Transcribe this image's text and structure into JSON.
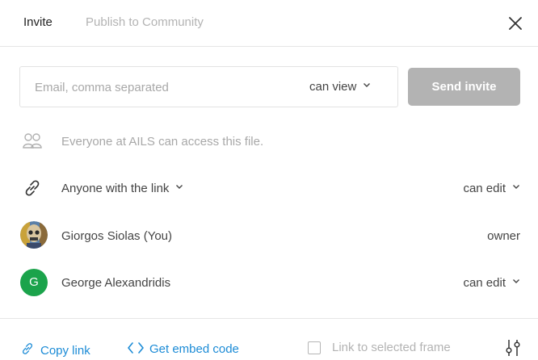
{
  "tabs": [
    {
      "label": "Invite",
      "active": true
    },
    {
      "label": "Publish to Community",
      "active": false
    }
  ],
  "invite": {
    "email_placeholder": "Email, comma separated",
    "email_value": "",
    "permission": "can view",
    "send_label": "Send invite"
  },
  "access": {
    "org_text": "Everyone at AILS can access this file.",
    "link_label": "Anyone with the link",
    "link_permission": "can edit"
  },
  "members": [
    {
      "name": "Giorgos Siolas (You)",
      "role": "owner",
      "avatar": "photo"
    },
    {
      "name": "George Alexandridis",
      "role": "can edit",
      "avatar_initial": "G",
      "avatar_color": "#1ba34b"
    }
  ],
  "footer": {
    "copy_link": "Copy link",
    "embed_code": "Get embed code",
    "link_frame": "Link to selected frame"
  },
  "icons": {
    "close": "close-icon",
    "chevron": "chevron-down-icon",
    "people": "people-icon",
    "link": "link-icon",
    "code": "code-icon",
    "settings": "sliders-icon"
  },
  "colors": {
    "accent": "#1b8bd6",
    "send_disabled": "#b3b3b3",
    "avatar_green": "#1ba34b"
  }
}
